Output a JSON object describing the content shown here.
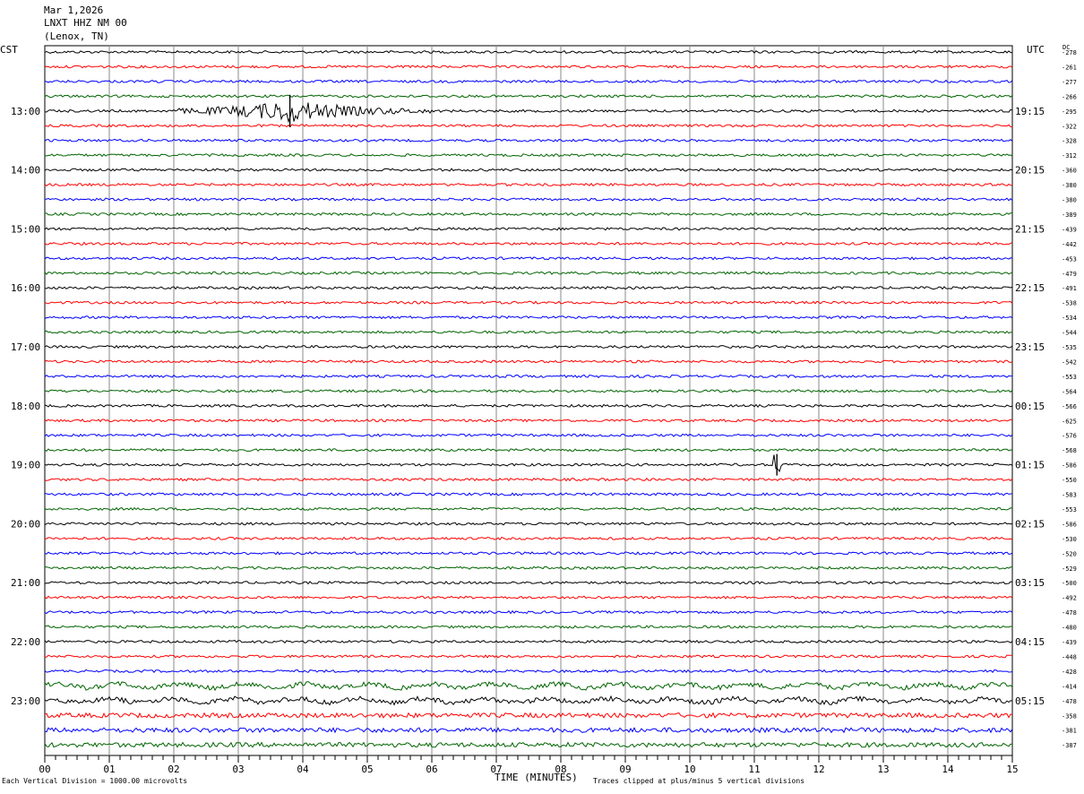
{
  "header": {
    "date": "Mar 1,2026",
    "station": "LNXT HHZ NM 00",
    "location": "(Lenox, TN)"
  },
  "left_timezone": "CST",
  "right_timezone": "UTC",
  "dc_label": "DC",
  "footer": {
    "scale_note": "Each Vertical Division = 1000.00 microvolts",
    "x_axis_title": "TIME (MINUTES)",
    "clip_note": "Traces clipped at plus/minus 5 vertical divisions"
  },
  "chart_data": {
    "type": "line",
    "title": "",
    "xlabel": "TIME (MINUTES)",
    "xlim": [
      0,
      15
    ],
    "x_ticks": [
      "00",
      "01",
      "02",
      "03",
      "04",
      "05",
      "06",
      "07",
      "08",
      "09",
      "10",
      "11",
      "12",
      "13",
      "14",
      "15"
    ],
    "trace_colors": [
      "#000000",
      "#ff0000",
      "#0000ff",
      "#006400"
    ],
    "left_hour_labels": [
      "13:00",
      "14:00",
      "15:00",
      "16:00",
      "17:00",
      "18:00",
      "19:00",
      "20:00",
      "21:00",
      "22:00",
      "23:00"
    ],
    "right_hour_labels": [
      "19:15",
      "20:15",
      "21:15",
      "22:15",
      "23:15",
      "00:15",
      "01:15",
      "02:15",
      "03:15",
      "04:15",
      "05:15"
    ],
    "hour_label_first_row": 4,
    "rows_per_hour": 4,
    "dc_offsets": [
      -278,
      -261,
      -277,
      -266,
      -295,
      -322,
      -328,
      -312,
      -360,
      -380,
      -380,
      -389,
      -439,
      -442,
      -453,
      -479,
      -491,
      -538,
      -534,
      -544,
      -535,
      -542,
      -553,
      -564,
      -566,
      -625,
      -576,
      -568,
      -586,
      -550,
      -583,
      -553,
      -586,
      -530,
      -520,
      -529,
      -500,
      -492,
      -478,
      -480,
      -439,
      -448,
      -428,
      -414,
      -478,
      -358,
      -381,
      -387
    ],
    "events": [
      {
        "row": 4,
        "minute": 3.8,
        "description": "earthquake signal"
      },
      {
        "row": 28,
        "minute": 11.35,
        "description": "spike"
      }
    ]
  }
}
